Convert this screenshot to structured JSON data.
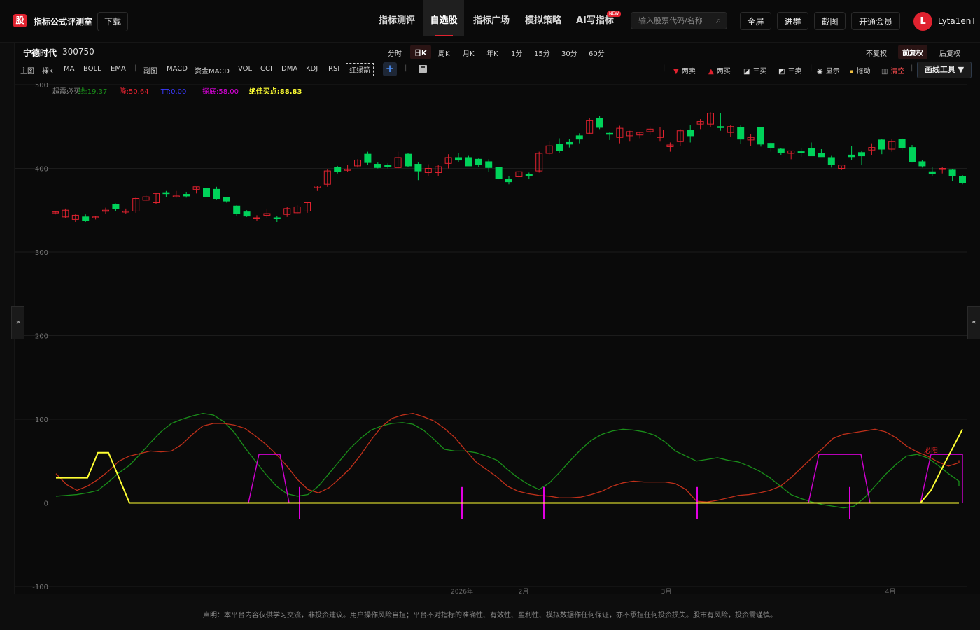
{
  "header": {
    "logo_text": "股",
    "title": "指标公式评测室",
    "download": "下载",
    "nav": [
      "指标测评",
      "自选股",
      "指标广场",
      "模拟策略",
      "AI写指标"
    ],
    "nav_active": 1,
    "new_badge": "NEW",
    "search_placeholder": "输入股票代码/名称",
    "buttons": [
      "全屏",
      "进群",
      "截图",
      "开通会员"
    ],
    "avatar_letter": "L",
    "username": "Lyta1enT"
  },
  "stock": {
    "name": "宁德时代",
    "code": "300750"
  },
  "periods": [
    "分时",
    "日K",
    "周K",
    "月K",
    "年K",
    "1分",
    "15分",
    "30分",
    "60分"
  ],
  "period_active": 1,
  "adjust": [
    "不复权",
    "前复权",
    "后复权"
  ],
  "adjust_active": 1,
  "main_group": {
    "label": "主图",
    "items": [
      "裸K",
      "MA",
      "BOLL",
      "EMA"
    ]
  },
  "sub_group": {
    "label": "副图",
    "items": [
      "MACD",
      "资金MACD",
      "VOL",
      "CCI",
      "DMA",
      "KDJ",
      "RSI",
      "红绿箭"
    ]
  },
  "draw_toolbar": {
    "items": [
      "两卖",
      "两买",
      "三买",
      "三卖",
      "显示",
      "拖动",
      "清空"
    ],
    "menu": "画线工具 ▼"
  },
  "colors": {
    "up": "#e0222f",
    "down": "#00d35a",
    "accent": "#e0222f",
    "clear": "#ff4d4f"
  },
  "chart_data": {
    "type": "candlestick",
    "y_ticks": [
      "500",
      "400",
      "300",
      "200",
      "100",
      "0",
      "-100"
    ],
    "x_ticks": [
      "2026年",
      "2月",
      "3月",
      "4月"
    ],
    "legend": [
      {
        "label": "超震必买",
        "color": "#888888"
      },
      {
        "label": "线:19.37",
        "color": "#1a8f1a"
      },
      {
        "label": "降:50.64",
        "color": "#e0222f"
      },
      {
        "label": "TT:0.00",
        "color": "#3a3aff"
      },
      {
        "label": "探底:58.00",
        "color": "#e600e6"
      },
      {
        "label": "绝佳买点:88.83",
        "color": "#ffff33"
      }
    ],
    "annotation": "必阳",
    "candles": [
      [
        347,
        349,
        345,
        348
      ],
      [
        342,
        352,
        341,
        350
      ],
      [
        339,
        345,
        336,
        344
      ],
      [
        342,
        345,
        336,
        338
      ],
      [
        341,
        343,
        339,
        342
      ],
      [
        349,
        353,
        346,
        350
      ],
      [
        357,
        358,
        349,
        352
      ],
      [
        349,
        352,
        346,
        349
      ],
      [
        349,
        365,
        347,
        364
      ],
      [
        362,
        368,
        361,
        366
      ],
      [
        359,
        371,
        357,
        370
      ],
      [
        371,
        373,
        366,
        370
      ],
      [
        367,
        373,
        365,
        367
      ],
      [
        369,
        372,
        365,
        367
      ],
      [
        375,
        378,
        370,
        378
      ],
      [
        376,
        377,
        366,
        366
      ],
      [
        375,
        378,
        363,
        364
      ],
      [
        365,
        365,
        359,
        361
      ],
      [
        355,
        356,
        343,
        346
      ],
      [
        348,
        350,
        342,
        343
      ],
      [
        341,
        344,
        337,
        341
      ],
      [
        344,
        352,
        341,
        346
      ],
      [
        341,
        343,
        336,
        340
      ],
      [
        345,
        354,
        342,
        352
      ],
      [
        347,
        356,
        346,
        354
      ],
      [
        349,
        360,
        347,
        359
      ],
      [
        377,
        379,
        373,
        379
      ],
      [
        381,
        399,
        378,
        397
      ],
      [
        401,
        403,
        394,
        396
      ],
      [
        398,
        404,
        396,
        399
      ],
      [
        403,
        411,
        401,
        410
      ],
      [
        417,
        420,
        404,
        407
      ],
      [
        405,
        407,
        400,
        401
      ],
      [
        404,
        406,
        400,
        402
      ],
      [
        401,
        420,
        400,
        413
      ],
      [
        417,
        418,
        402,
        403
      ],
      [
        405,
        407,
        386,
        397
      ],
      [
        395,
        405,
        391,
        400
      ],
      [
        395,
        404,
        391,
        402
      ],
      [
        406,
        417,
        400,
        413
      ],
      [
        413,
        418,
        408,
        410
      ],
      [
        413,
        415,
        406,
        403
      ],
      [
        411,
        412,
        402,
        405
      ],
      [
        408,
        411,
        396,
        401
      ],
      [
        401,
        402,
        387,
        388
      ],
      [
        387,
        391,
        381,
        384
      ],
      [
        390,
        397,
        389,
        396
      ],
      [
        393,
        395,
        387,
        391
      ],
      [
        397,
        420,
        395,
        418
      ],
      [
        418,
        432,
        416,
        427
      ],
      [
        429,
        436,
        418,
        421
      ],
      [
        431,
        435,
        425,
        429
      ],
      [
        439,
        442,
        430,
        435
      ],
      [
        442,
        460,
        441,
        457
      ],
      [
        460,
        463,
        447,
        449
      ],
      [
        442,
        443,
        434,
        441
      ],
      [
        437,
        451,
        430,
        448
      ],
      [
        439,
        445,
        432,
        444
      ],
      [
        440,
        444,
        436,
        443
      ],
      [
        444,
        450,
        440,
        447
      ],
      [
        437,
        449,
        432,
        446
      ],
      [
        426,
        431,
        420,
        428
      ],
      [
        432,
        447,
        427,
        445
      ],
      [
        446,
        452,
        431,
        439
      ],
      [
        453,
        459,
        447,
        456
      ],
      [
        453,
        467,
        449,
        466
      ],
      [
        450,
        466,
        445,
        449
      ],
      [
        443,
        452,
        438,
        450
      ],
      [
        449,
        452,
        429,
        435
      ],
      [
        434,
        441,
        427,
        437
      ],
      [
        449,
        449,
        426,
        429
      ],
      [
        430,
        431,
        420,
        425
      ],
      [
        423,
        424,
        416,
        419
      ],
      [
        418,
        421,
        411,
        421
      ],
      [
        420,
        424,
        414,
        419
      ],
      [
        424,
        431,
        416,
        415
      ],
      [
        418,
        423,
        414,
        414
      ],
      [
        413,
        415,
        401,
        405
      ],
      [
        400,
        403,
        398,
        404
      ],
      [
        416,
        427,
        410,
        414
      ],
      [
        419,
        421,
        404,
        415
      ],
      [
        422,
        430,
        416,
        425
      ],
      [
        434,
        435,
        417,
        423
      ],
      [
        423,
        435,
        420,
        432
      ],
      [
        435,
        436,
        422,
        425
      ],
      [
        425,
        428,
        407,
        408
      ],
      [
        408,
        410,
        401,
        403
      ],
      [
        396,
        402,
        391,
        394
      ],
      [
        399,
        402,
        394,
        400
      ],
      [
        398,
        399,
        385,
        391
      ],
      [
        390,
        392,
        381,
        383
      ]
    ],
    "indicator_xs": [
      80,
      95,
      110,
      125,
      140,
      155,
      170,
      185,
      200,
      215,
      230,
      245,
      260,
      275,
      290,
      305,
      320,
      335,
      350,
      365,
      380,
      395,
      410,
      425,
      440,
      455,
      470,
      485,
      500,
      515,
      530,
      545,
      560,
      575,
      590,
      605,
      620,
      635,
      650,
      665,
      680,
      695,
      710,
      725,
      740,
      755,
      770,
      785,
      800,
      815,
      830,
      845,
      860,
      875,
      890,
      905,
      920,
      935,
      950,
      965,
      980,
      995,
      1010,
      1025,
      1040,
      1055,
      1070,
      1085,
      1100,
      1115,
      1130,
      1145,
      1160,
      1175,
      1190,
      1205,
      1220,
      1235,
      1250,
      1265,
      1280,
      1295,
      1310,
      1325,
      1340,
      1355,
      1370
    ],
    "green_line": [
      8,
      9,
      10,
      12,
      15,
      25,
      36,
      45,
      58,
      72,
      85,
      95,
      100,
      104,
      107,
      105,
      97,
      84,
      66,
      50,
      34,
      20,
      11,
      8,
      10,
      20,
      35,
      50,
      65,
      77,
      87,
      92,
      95,
      96,
      94,
      87,
      76,
      64,
      62,
      62,
      60,
      56,
      51,
      40,
      30,
      22,
      16,
      24,
      37,
      51,
      64,
      75,
      82,
      86,
      88,
      87,
      85,
      81,
      73,
      62,
      56,
      50,
      52,
      54,
      51,
      49,
      44,
      38,
      30,
      20,
      10,
      5,
      1,
      -2,
      -4,
      -6,
      -4,
      6,
      20,
      34,
      46,
      56,
      58,
      54,
      45,
      35,
      26,
      20
    ],
    "red_line": [
      35,
      22,
      15,
      20,
      28,
      38,
      50,
      56,
      59,
      62,
      61,
      62,
      70,
      82,
      92,
      95,
      95,
      93,
      89,
      80,
      70,
      58,
      44,
      28,
      16,
      12,
      18,
      29,
      41,
      57,
      75,
      91,
      101,
      105,
      107,
      103,
      98,
      89,
      78,
      63,
      49,
      40,
      31,
      20,
      14,
      11,
      9,
      8,
      6,
      6,
      7,
      10,
      14,
      20,
      24,
      26,
      25,
      25,
      25,
      23,
      16,
      2,
      1,
      3,
      6,
      9,
      10,
      12,
      15,
      20,
      30,
      42,
      54,
      65,
      77,
      82,
      84,
      86,
      88,
      85,
      78,
      68,
      61,
      56,
      49,
      44,
      48,
      51
    ],
    "yellow_line": [
      30,
      30,
      30,
      30,
      60,
      60,
      30,
      0,
      0,
      0,
      0,
      0,
      0,
      0,
      0,
      0,
      0,
      0,
      0,
      0,
      0,
      0,
      0,
      0,
      0,
      0,
      0,
      0,
      0,
      0,
      0,
      0,
      0,
      0,
      0,
      0,
      0,
      0,
      0,
      0,
      0,
      0,
      0,
      0,
      0,
      0,
      0,
      0,
      0,
      0,
      0,
      0,
      0,
      0,
      0,
      0,
      0,
      0,
      0,
      0,
      0,
      0,
      0,
      0,
      0,
      0,
      0,
      0,
      0,
      0,
      0,
      0,
      0,
      0,
      0,
      0,
      0,
      0,
      0,
      0,
      0,
      0,
      0,
      0,
      0,
      0,
      0,
      0,
      0,
      15,
      40,
      64,
      88
    ],
    "magenta_trapezoids": [
      [
        355,
        370,
        400,
        413
      ],
      [
        1155,
        1170,
        1230,
        1243
      ],
      [
        1315,
        1330,
        1375,
        1375
      ]
    ],
    "magenta_trapezoid_value": 58,
    "magenta_ticks_x": [
      428,
      660,
      777,
      996,
      1214
    ]
  },
  "footer": "声明：本平台内容仅供学习交流，非投资建议。用户操作风险自担；平台不对指标的准确性、有效性、盈利性、模拟数据作任何保证，亦不承担任何投资损失。股市有风险，投资需谨慎。"
}
